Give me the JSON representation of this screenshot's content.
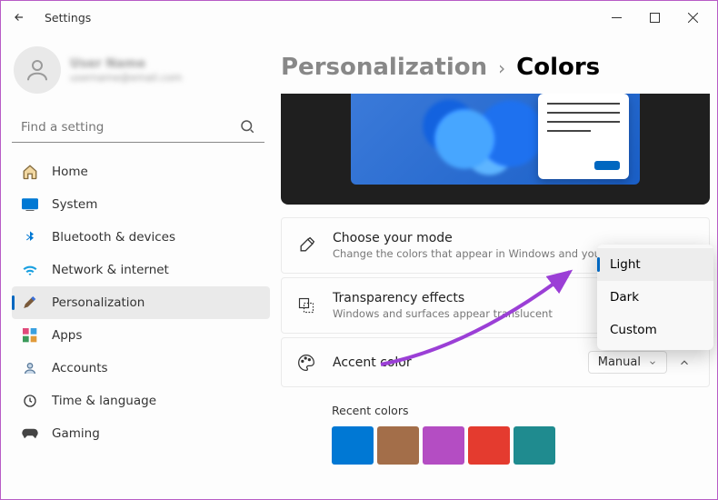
{
  "window": {
    "title": "Settings"
  },
  "user": {
    "name": "User Name",
    "email": "username@email.com"
  },
  "search": {
    "placeholder": "Find a setting"
  },
  "sidebar": {
    "items": [
      {
        "label": "Home"
      },
      {
        "label": "System"
      },
      {
        "label": "Bluetooth & devices"
      },
      {
        "label": "Network & internet"
      },
      {
        "label": "Personalization"
      },
      {
        "label": "Apps"
      },
      {
        "label": "Accounts"
      },
      {
        "label": "Time & language"
      },
      {
        "label": "Gaming"
      }
    ]
  },
  "breadcrumb": {
    "parent": "Personalization",
    "current": "Colors"
  },
  "cards": {
    "mode": {
      "title": "Choose your mode",
      "sub": "Change the colors that appear in Windows and your apps",
      "options": [
        "Light",
        "Dark",
        "Custom"
      ],
      "selected": "Light"
    },
    "transparency": {
      "title": "Transparency effects",
      "sub": "Windows and surfaces appear translucent"
    },
    "accent": {
      "title": "Accent color",
      "value": "Manual"
    }
  },
  "recent": {
    "label": "Recent colors",
    "colors": [
      "#0078d4",
      "#a36e49",
      "#b44dc3",
      "#e43b2f",
      "#1f8b8f"
    ]
  }
}
